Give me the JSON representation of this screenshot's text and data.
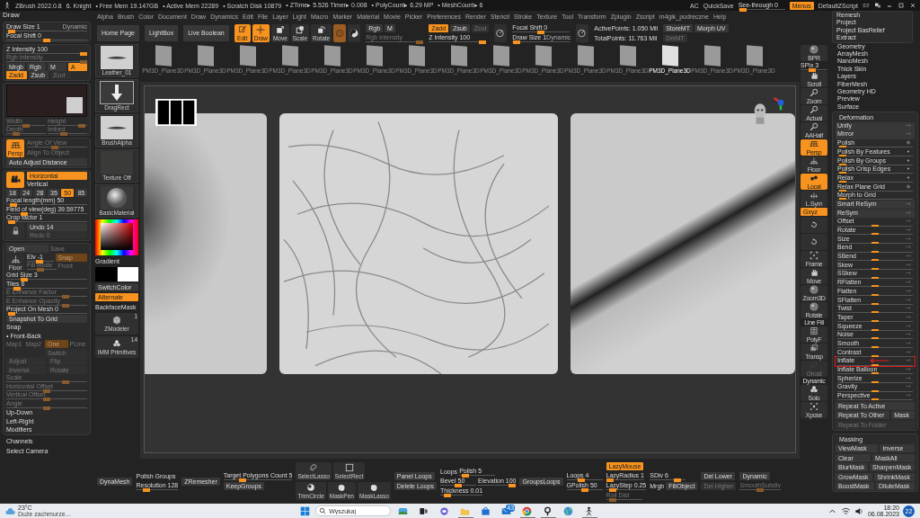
{
  "title_bar": {
    "app": "ZBrush 2022.0.8",
    "document": "6. Knight",
    "stats": [
      "• Free Mem 19.147GB",
      "• Active Mem 22289",
      "• Scratch Disk 10879",
      "• ZTime▸ 5.526 Timer▸ 0.008",
      "• PolyCount▸ 6.29 MP",
      "• MeshCount▸ 6"
    ],
    "right": [
      "AC",
      "QuickSave"
    ],
    "see_through": {
      "kind": "slider",
      "label": "See-through 0",
      "level": 0.02,
      "disabled": false
    },
    "menus_button": {
      "kind": "button",
      "label": "Menus",
      "active": true,
      "disabled": false
    },
    "script": "DefaultZScript"
  },
  "menu_bar": [
    "Alpha",
    "Brush",
    "Color",
    "Document",
    "Draw",
    "Dynamics",
    "Edit",
    "File",
    "Layer",
    "Light",
    "Macro",
    "Marker",
    "Material",
    "Movie",
    "Picker",
    "Preferences",
    "Render",
    "Stencil",
    "Stroke",
    "Texture",
    "Tool",
    "Transform",
    "Zplugin",
    "Zscript",
    "m4gik_podreczne",
    "Help"
  ],
  "left_panel": {
    "title": "Draw",
    "groups": [
      {
        "rows": [
          {
            "cells": [
              {
                "kind": "slider",
                "label": "Draw Size 1",
                "tag": "Dynamic",
                "level": 0.02,
                "disabled": false
              }
            ]
          },
          {
            "cells": [
              {
                "kind": "slider",
                "label": "Focal Shift 0",
                "level": 0.5,
                "disabled": false
              }
            ]
          }
        ]
      },
      {
        "rows": [
          {
            "cells": [
              {
                "kind": "slider",
                "label": "Z Intensity 100",
                "level": 1,
                "disabled": false
              }
            ]
          },
          {
            "cells": [
              {
                "kind": "slider",
                "label": "Rgb Intensity",
                "level": 1,
                "disabled": true
              }
            ]
          },
          {
            "cells": [
              {
                "kind": "button",
                "label": "Mrgb",
                "active": false,
                "disabled": false
              },
              {
                "kind": "button",
                "label": "Rgb",
                "active": false,
                "disabled": false
              },
              {
                "kind": "button",
                "label": "M",
                "active": false,
                "disabled": false
              },
              {
                "kind": "button",
                "label": "A",
                "active": true,
                "disabled": false
              }
            ]
          },
          {
            "cells": [
              {
                "kind": "button",
                "label": "Zadd",
                "active": true,
                "disabled": false
              },
              {
                "kind": "button",
                "label": "Zsub",
                "active": false,
                "disabled": false
              },
              {
                "kind": "button",
                "label": "Zcut",
                "active": false,
                "disabled": true
              },
              {
                "kind": "space"
              }
            ]
          }
        ]
      },
      {
        "rows": [
          {
            "kind": "texture"
          },
          {
            "cells": [
              {
                "kind": "slider",
                "label": "Width",
                "level": 0.5,
                "disabled": true
              },
              {
                "kind": "slider",
                "label": "Height",
                "level": 0.95,
                "disabled": true
              }
            ]
          },
          {
            "cells": [
              {
                "kind": "slider",
                "label": "Depth",
                "level": 0.2,
                "disabled": true
              },
              {
                "kind": "slider",
                "label": "Imbed",
                "level": 0.4,
                "disabled": true
              }
            ]
          }
        ]
      },
      {
        "rows": [
          {
            "kind": "persp",
            "label": "Persp",
            "active": true,
            "rows": [
              {
                "cells": [
                  {
                    "kind": "slider",
                    "label": "Angle Of View",
                    "level": 0.45,
                    "disabled": true
                  }
                ]
              },
              {
                "cells": [
                  {
                    "kind": "text",
                    "label": "Align To Object",
                    "disabled": true
                  }
                ]
              }
            ]
          },
          {
            "cells": [
              {
                "kind": "button",
                "label": "Auto Adjust Distance",
                "active": false,
                "disabled": false
              }
            ]
          }
        ]
      },
      {
        "rows": [
          {
            "kind": "camera",
            "active": true,
            "rows": [
              {
                "cells": [
                  {
                    "kind": "button",
                    "label": "Horizontal",
                    "active": true,
                    "disabled": false
                  }
                ]
              },
              {
                "cells": [
                  {
                    "kind": "text",
                    "label": "Vertical",
                    "disabled": false
                  }
                ]
              }
            ]
          },
          {
            "cells": [
              {
                "kind": "button",
                "label": "18",
                "active": false,
                "disabled": false
              },
              {
                "kind": "button",
                "label": "24",
                "active": false,
                "disabled": false
              },
              {
                "kind": "button",
                "label": "28",
                "active": false,
                "disabled": false
              },
              {
                "kind": "button",
                "label": "35",
                "active": false,
                "disabled": false
              },
              {
                "kind": "button",
                "label": "50",
                "active": true,
                "disabled": false
              },
              {
                "kind": "button",
                "label": "85",
                "active": false,
                "disabled": false
              }
            ]
          },
          {
            "cells": [
              {
                "kind": "slider",
                "label": "Focal length(mm) 50",
                "level": 0.05,
                "disabled": false
              }
            ]
          },
          {
            "cells": [
              {
                "kind": "slider",
                "label": "Field of view(deg) 39.59775",
                "level": 0.2,
                "disabled": false
              }
            ]
          },
          {
            "cells": [
              {
                "kind": "slider",
                "label": "Crop factor 1",
                "level": 0.03,
                "disabled": false
              }
            ]
          },
          {
            "kind": "lock",
            "active": false,
            "rows": [
              {
                "cells": [
                  {
                    "kind": "button",
                    "label": "Undo 14",
                    "active": false,
                    "disabled": false
                  }
                ]
              },
              {
                "cells": [
                  {
                    "kind": "button",
                    "label": "Redo 0",
                    "active": false,
                    "disabled": true
                  }
                ]
              }
            ]
          }
        ]
      },
      {
        "rows": [
          {
            "cells": [
              {
                "kind": "button",
                "label": "Open",
                "active": false,
                "disabled": false
              },
              {
                "kind": "text",
                "label": "Save",
                "disabled": true
              }
            ]
          },
          {
            "kind": "floor",
            "label": "Floor",
            "active": false,
            "rows": [
              {
                "cells": [
                  {
                    "kind": "slider",
                    "label": "Elv -1",
                    "level": 0.45,
                    "disabled": false
                  },
                  {
                    "kind": "button",
                    "label": "Snap",
                    "active": true,
                    "disabled": true
                  }
                ]
              },
              {
                "cells": [
                  {
                    "kind": "slider",
                    "label": "Fill Mode",
                    "level": 0.45,
                    "disabled": true
                  },
                  {
                    "kind": "text",
                    "label": "Front",
                    "disabled": true
                  }
                ]
              }
            ]
          },
          {
            "cells": [
              {
                "kind": "slider",
                "label": "Grid Size 3",
                "level": 0.2,
                "disabled": false
              }
            ]
          },
          {
            "cells": [
              {
                "kind": "slider",
                "label": "Tiles 6",
                "level": 0.1,
                "disabled": false
              }
            ]
          },
          {
            "cells": [
              {
                "kind": "slider",
                "label": "E Enhance Factor",
                "level": 0.75,
                "disabled": true
              }
            ]
          },
          {
            "cells": [
              {
                "kind": "slider",
                "label": "E Enhance Opacity",
                "level": 0.75,
                "disabled": true
              }
            ]
          },
          {
            "cells": [
              {
                "kind": "slider",
                "label": "Project On Mesh 0",
                "level": 0.02,
                "disabled": false
              }
            ]
          },
          {
            "cells": [
              {
                "kind": "button",
                "label": "Snapshot To Grid",
                "active": false,
                "disabled": false
              }
            ]
          },
          {
            "cells": [
              {
                "kind": "text",
                "label": "Snap",
                "disabled": false
              }
            ]
          },
          {
            "cells": [
              {
                "kind": "text",
                "label": "• Front-Back",
                "disabled": false
              }
            ]
          },
          {
            "cells": [
              {
                "kind": "text",
                "label": "Map1",
                "disabled": true
              },
              {
                "kind": "text",
                "label": "Map2",
                "disabled": true
              },
              {
                "kind": "button",
                "label": "One",
                "active": true,
                "disabled": true
              },
              {
                "kind": "text",
                "label": "PLine",
                "disabled": true
              }
            ]
          },
          {
            "cells": [
              {
                "kind": "space"
              },
              {
                "kind": "button",
                "label": "Switch",
                "active": false,
                "disabled": true
              }
            ]
          },
          {
            "cells": [
              {
                "kind": "button",
                "label": "Adjust",
                "active": false,
                "disabled": true
              },
              {
                "kind": "button",
                "label": "Flip",
                "active": false,
                "disabled": true
              }
            ]
          },
          {
            "cells": [
              {
                "kind": "button",
                "label": "Inverse",
                "active": false,
                "disabled": true
              },
              {
                "kind": "button",
                "label": "Rotate",
                "active": false,
                "disabled": true
              }
            ]
          },
          {
            "cells": [
              {
                "kind": "slider",
                "label": "Scale",
                "level": 0.75,
                "disabled": true
              }
            ]
          },
          {
            "cells": [
              {
                "kind": "slider",
                "label": "Horizontal Offset",
                "level": 0.5,
                "disabled": true
              }
            ]
          },
          {
            "cells": [
              {
                "kind": "slider",
                "label": "Vertical Offset",
                "level": 0.5,
                "disabled": true
              }
            ]
          },
          {
            "cells": [
              {
                "kind": "slider",
                "label": "Angle",
                "level": 0.5,
                "disabled": true
              }
            ]
          },
          {
            "cells": [
              {
                "kind": "text",
                "label": "Up-Down",
                "disabled": false
              }
            ]
          },
          {
            "cells": [
              {
                "kind": "text",
                "label": "Left-Right",
                "disabled": false
              }
            ]
          },
          {
            "cells": [
              {
                "kind": "text",
                "label": "Modifiers",
                "disabled": false
              }
            ]
          }
        ]
      }
    ],
    "footer": [
      "Channels",
      "Select Camera"
    ]
  },
  "top_shelf": [
    {
      "rows": [
        {
          "cells": [
            {
              "kind": "button",
              "label": "Home Page",
              "active": false,
              "disabled": false
            }
          ]
        }
      ]
    },
    {
      "rows": [
        {
          "cells": [
            {
              "kind": "button",
              "label": "LightBox",
              "active": false,
              "disabled": false
            }
          ]
        }
      ]
    },
    {
      "rows": [
        {
          "cells": [
            {
              "kind": "button",
              "label": "Live Boolean",
              "active": false,
              "disabled": false
            }
          ]
        }
      ]
    },
    {
      "rows": [
        {
          "cells": [
            {
              "kind": "edit",
              "label": "Edit",
              "active": true,
              "disabled": false
            },
            {
              "kind": "draw",
              "label": "Draw",
              "active": true,
              "disabled": false
            },
            {
              "kind": "move",
              "label": "Move",
              "active": false,
              "disabled": false
            },
            {
              "kind": "scale",
              "label": "Scale",
              "active": false,
              "disabled": false
            },
            {
              "kind": "rotate",
              "label": "Rotate",
              "active": false,
              "disabled": false
            },
            {
              "kind": "material",
              "active": true,
              "disabled": true
            },
            {
              "kind": "swirl",
              "active": false,
              "disabled": false
            }
          ]
        }
      ]
    },
    {
      "rows": [
        {
          "cells": [
            {
              "kind": "button",
              "label": "Rgb",
              "active": false,
              "disabled": false
            },
            {
              "kind": "button",
              "label": "M",
              "active": false,
              "disabled": false
            }
          ]
        },
        {
          "cells": [
            {
              "kind": "slider",
              "label": "Rgb Intensity",
              "level": 1,
              "disabled": true
            }
          ]
        }
      ]
    },
    {
      "rows": [
        {
          "cells": [
            {
              "kind": "button",
              "label": "Zadd",
              "active": true,
              "disabled": false
            },
            {
              "kind": "button",
              "label": "Zsub",
              "active": false,
              "disabled": false
            },
            {
              "kind": "button",
              "label": "Zcut",
              "active": false,
              "disabled": true
            }
          ]
        },
        {
          "cells": [
            {
              "kind": "slider",
              "label": "Z Intensity 100",
              "level": 1,
              "disabled": false
            }
          ]
        }
      ]
    },
    {
      "rows": [
        {
          "cells": [
            {
              "kind": "dial",
              "active": false,
              "disabled": false
            }
          ]
        }
      ]
    },
    {
      "rows": [
        {
          "cells": [
            {
              "kind": "slider",
              "label": "Focal Shift 0",
              "level": 0.5,
              "disabled": false
            }
          ]
        },
        {
          "cells": [
            {
              "kind": "slider",
              "label": "Draw Size 1",
              "tag": "Dynamic",
              "level": 0.02,
              "disabled": false
            }
          ]
        }
      ]
    },
    {
      "rows": [
        {
          "cells": [
            {
              "kind": "dial",
              "active": false,
              "disabled": false
            }
          ]
        }
      ]
    },
    {
      "rows": [
        {
          "cells": [
            {
              "kind": "text",
              "label": "ActivePoints: 1.050 Mil",
              "disabled": false
            }
          ]
        },
        {
          "cells": [
            {
              "kind": "text",
              "label": "TotalPoints: 11.763 Mil",
              "disabled": false
            }
          ]
        }
      ]
    },
    {
      "rows": [
        {
          "cells": [
            {
              "kind": "button",
              "label": "StoreMT",
              "active": false,
              "disabled": false
            },
            {
              "kind": "button",
              "label": "Morph UV",
              "active": false,
              "disabled": false
            }
          ]
        },
        {
          "cells": [
            {
              "kind": "button",
              "label": "DelMT",
              "active": false,
              "disabled": true
            },
            {
              "kind": "space"
            }
          ]
        }
      ]
    }
  ],
  "tool_column": [
    {
      "kind": "stroke_thumb",
      "label": "Leather_01"
    },
    {
      "kind": "arrow_thumb",
      "label": "DragRect"
    },
    {
      "kind": "stroke_thumb",
      "label": "BrushAlpha"
    },
    {
      "kind": "blank_thumb",
      "label": "Texture Off"
    },
    {
      "kind": "sphere_thumb",
      "label": "BasicMaterial"
    },
    {
      "kind": "picker"
    },
    {
      "kind": "text",
      "label": "Gradient",
      "disabled": false
    },
    {
      "kind": "swatches"
    },
    {
      "kind": "button",
      "label": "SwitchColor",
      "active": false,
      "disabled": false
    },
    {
      "kind": "button",
      "label": "Alternate",
      "active": true,
      "disabled": false
    },
    {
      "kind": "text",
      "label": "BackfaceMask",
      "disabled": false
    },
    {
      "kind": "cube",
      "label": "ZModeler",
      "count": "1",
      "active": false,
      "disabled": false
    },
    {
      "kind": "solo",
      "label": "IMM Primitives",
      "count": "14",
      "active": false,
      "disabled": false
    }
  ],
  "subtool_strip": [
    {
      "label": "PM3D_Plane3D",
      "selected": false
    },
    {
      "label": "PM3D_Plane3D",
      "selected": false
    },
    {
      "label": "PM3D_Plane3D",
      "selected": false
    },
    {
      "label": "PM3D_Plane3D",
      "selected": false
    },
    {
      "label": "PM3D_Plane3D",
      "selected": false
    },
    {
      "label": "PM3D_Plane3D",
      "selected": false
    },
    {
      "label": "PM3D_Plane3D",
      "selected": false
    },
    {
      "label": "PM3D_Plane3D",
      "selected": false
    },
    {
      "label": "PM3D_Plane3D",
      "selected": false
    },
    {
      "label": "PM3D_Plane3D",
      "selected": false
    },
    {
      "label": "PM3D_Plane3D",
      "selected": false
    },
    {
      "label": "PM3D_Plane3D",
      "selected": false
    },
    {
      "label": "PM3D_Plane3D",
      "selected": true
    },
    {
      "label": "PM3D_Plane3D",
      "selected": false
    },
    {
      "label": "PM3D_Plane3D",
      "selected": false
    }
  ],
  "bottom_shelf": [
    {
      "rows": [
        {
          "cells": [
            {
              "kind": "button",
              "label": "DynaMesh",
              "active": false,
              "disabled": false
            }
          ]
        }
      ]
    },
    {
      "rows": [
        {
          "cells": [
            {
              "kind": "text",
              "label": "Polish",
              "disabled": false
            },
            {
              "kind": "text",
              "label": "Groups",
              "disabled": false
            }
          ]
        },
        {
          "cells": [
            {
              "kind": "slider",
              "label": "Resolution 128",
              "level": 0.2,
              "disabled": false
            }
          ]
        }
      ]
    },
    {
      "rows": [
        {
          "cells": [
            {
              "kind": "button",
              "label": "ZRemesher",
              "active": false,
              "disabled": false
            }
          ]
        }
      ]
    },
    {
      "rows": [
        {
          "cells": [
            {
              "kind": "slider",
              "label": "Target Polygons Count 5",
              "level": 0.25,
              "disabled": false
            }
          ]
        },
        {
          "cells": [
            {
              "kind": "button",
              "label": "KeepGroups",
              "active": false,
              "disabled": false
            }
          ]
        }
      ]
    },
    {
      "rows": [
        {
          "cells": [
            {
              "kind": "lasso",
              "label": "SelectLasso",
              "active": false,
              "disabled": false
            },
            {
              "kind": "square",
              "label": "SelectRect",
              "active": false,
              "disabled": false
            }
          ]
        },
        {
          "cells": [
            {
              "kind": "ball",
              "label": "TrimCircle",
              "active": false,
              "disabled": false
            },
            {
              "kind": "blob",
              "label": "MaskPen",
              "active": false,
              "disabled": false
            },
            {
              "kind": "blob",
              "label": "MaskLasso",
              "active": false,
              "disabled": false
            }
          ]
        }
      ]
    },
    {
      "rows": [
        {
          "cells": [
            {
              "kind": "button",
              "label": "Panel Loops",
              "active": false,
              "disabled": false
            }
          ]
        },
        {
          "cells": [
            {
              "kind": "button",
              "label": "Delete Loops",
              "active": false,
              "disabled": false
            }
          ]
        }
      ]
    },
    {
      "rows": [
        {
          "cells": [
            {
              "kind": "text",
              "label": "Loops",
              "disabled": false
            },
            {
              "kind": "slider",
              "label": "Polish 5",
              "level": 0.1,
              "disabled": false
            }
          ]
        },
        {
          "cells": [
            {
              "kind": "slider",
              "label": "Bevel 50",
              "level": 0.5,
              "disabled": false
            },
            {
              "kind": "slider",
              "label": "Elevation 100",
              "level": 1,
              "disabled": false
            }
          ]
        },
        {
          "cells": [
            {
              "kind": "slider",
              "label": "Thickness 0.01",
              "level": 0.1,
              "disabled": false
            }
          ]
        }
      ]
    },
    {
      "rows": [
        {
          "cells": [
            {
              "kind": "button",
              "label": "GroupsLoops",
              "active": false,
              "disabled": false
            }
          ]
        }
      ]
    },
    {
      "rows": [
        {
          "cells": [
            {
              "kind": "slider",
              "label": "Loops 4",
              "level": 0.4,
              "disabled": false
            }
          ]
        },
        {
          "cells": [
            {
              "kind": "slider",
              "label": "GPolish 50",
              "level": 0.5,
              "disabled": false
            }
          ]
        }
      ]
    },
    {
      "rows": [
        {
          "cells": [
            {
              "kind": "button",
              "label": "LazyMouse",
              "active": true,
              "disabled": false
            }
          ]
        },
        {
          "cells": [
            {
              "kind": "slider",
              "label": "LazyRadius 1",
              "level": 0.02,
              "disabled": false
            }
          ]
        },
        {
          "cells": [
            {
              "kind": "slider",
              "label": "LazyStep 0.25",
              "level": 0.1,
              "disabled": false
            }
          ]
        },
        {
          "cells": [
            {
              "kind": "slider",
              "label": "Roll Dist",
              "level": 0.1,
              "disabled": true
            }
          ]
        }
      ]
    },
    {
      "rows": [
        {
          "cells": [
            {
              "kind": "slider",
              "label": "SDiv 6",
              "level": 0.85,
              "disabled": false
            }
          ]
        },
        {
          "cells": [
            {
              "kind": "text",
              "label": "Mrgb",
              "disabled": false
            },
            {
              "kind": "button",
              "label": "FillObject",
              "active": false,
              "disabled": false
            }
          ]
        }
      ]
    },
    {
      "rows": [
        {
          "cells": [
            {
              "kind": "button",
              "label": "Del Lower",
              "active": false,
              "disabled": false
            }
          ]
        },
        {
          "cells": [
            {
              "kind": "button",
              "label": "Del Higher",
              "active": false,
              "disabled": true
            }
          ]
        }
      ]
    },
    {
      "rows": [
        {
          "cells": [
            {
              "kind": "button",
              "label": "Dynamic",
              "active": false,
              "disabled": false
            }
          ]
        },
        {
          "cells": [
            {
              "kind": "slider",
              "label": "SmoothSubdiv",
              "level": 0.5,
              "disabled": true
            }
          ]
        }
      ]
    }
  ],
  "view_shelf": [
    {
      "kind": "sphere",
      "label": "BPR",
      "active": false,
      "disabled": false
    },
    {
      "kind": "slider",
      "label": "SPix 3",
      "level": 0.4,
      "disabled": false
    },
    {
      "kind": "hand",
      "label": "Scroll",
      "active": false,
      "disabled": false
    },
    {
      "kind": "zoom",
      "label": "Zoom",
      "active": false,
      "disabled": false
    },
    {
      "kind": "zoom",
      "label": "Actual",
      "active": false,
      "disabled": false
    },
    {
      "kind": "zoom",
      "label": "AAHalf",
      "active": false,
      "disabled": false
    },
    {
      "kind": "persp",
      "label": "Persp",
      "active": true,
      "disabled": false
    },
    {
      "kind": "floor",
      "label": "Floor",
      "active": false,
      "disabled": false
    },
    {
      "kind": "local",
      "label": "Local",
      "active": true,
      "disabled": false
    },
    {
      "kind": "lsym",
      "label": "L.Sym",
      "active": false,
      "disabled": false
    },
    {
      "kind": "button",
      "label": "Gxyz",
      "active": true,
      "disabled": false
    },
    {
      "kind": "rot",
      "active": false,
      "disabled": false
    },
    {
      "kind": "rot",
      "active": false,
      "disabled": false
    },
    {
      "kind": "frame",
      "label": "Frame",
      "active": false,
      "disabled": false
    },
    {
      "kind": "hand",
      "label": "Move",
      "active": false,
      "disabled": false
    },
    {
      "kind": "sphere",
      "label": "Zoom3D",
      "active": false,
      "disabled": false
    },
    {
      "kind": "sphere",
      "label": "Rotate",
      "active": false,
      "disabled": false
    },
    {
      "kind": "text",
      "label": "Line Fill",
      "disabled": false
    },
    {
      "kind": "grid",
      "label": "PolyF",
      "active": false,
      "disabled": false
    },
    {
      "kind": "layers",
      "label": "Transp",
      "active": false,
      "disabled": false
    },
    {
      "kind": "ghost",
      "label": "Ghost",
      "active": false,
      "disabled": true
    },
    {
      "kind": "text",
      "label": "Dynamic",
      "disabled": false
    },
    {
      "kind": "solo",
      "label": "Solo",
      "active": false,
      "disabled": false
    },
    {
      "kind": "xpose",
      "label": "Xpose",
      "active": false,
      "disabled": false
    }
  ],
  "right_panel": {
    "dropdown": [
      "Remesh",
      "Project",
      "Project BasRelief",
      "Extract"
    ],
    "subpalettes": [
      "Geometry",
      "ArrayMesh",
      "NanoMesh",
      "Thick Skin",
      "Layers",
      "FiberMesh",
      "Geometry HD",
      "Preview",
      "Surface"
    ],
    "deformation": {
      "title": "Deformation",
      "items": [
        {
          "kind": "button_xyz",
          "label": "Unify",
          "highlighted": false
        },
        {
          "kind": "button_xyz",
          "label": "Mirror",
          "highlighted": false
        },
        {
          "kind": "slider_circle",
          "label": "Polish",
          "level": 0.02,
          "highlighted": false
        },
        {
          "kind": "slider_dot",
          "label": "Polish By Features",
          "level": 0.02,
          "highlighted": false
        },
        {
          "kind": "slider_dot",
          "label": "Polish By Groups",
          "level": 0.02,
          "highlighted": false
        },
        {
          "kind": "slider_dot",
          "label": "Polish Crisp Edges",
          "level": 0.02,
          "highlighted": false
        },
        {
          "kind": "slider_dot",
          "label": "Relax",
          "level": 0.02,
          "highlighted": false
        },
        {
          "kind": "slider_circle",
          "label": "Relax Plane Grid",
          "level": 0.02,
          "highlighted": false
        },
        {
          "kind": "slider",
          "label": "Morph to Grid",
          "level": 0.02,
          "highlighted": false
        },
        {
          "kind": "button_xyz",
          "label": "Smart ReSym",
          "highlighted": false
        },
        {
          "kind": "button_xyz",
          "label": "ReSym",
          "highlighted": false
        },
        {
          "kind": "slider_xyz",
          "label": "Offset",
          "level": 0.5,
          "highlighted": false
        },
        {
          "kind": "slider_xyz",
          "label": "Rotate",
          "level": 0.5,
          "highlighted": false
        },
        {
          "kind": "slider_xyz",
          "label": "Size",
          "level": 0.5,
          "highlighted": false
        },
        {
          "kind": "slider_xyz",
          "label": "Bend",
          "level": 0.5,
          "highlighted": false
        },
        {
          "kind": "slider_xyz",
          "label": "SBend",
          "level": 0.5,
          "highlighted": false
        },
        {
          "kind": "slider_xyz",
          "label": "Skew",
          "level": 0.5,
          "highlighted": false
        },
        {
          "kind": "slider_xyz",
          "label": "SSkew",
          "level": 0.5,
          "highlighted": false
        },
        {
          "kind": "slider_xyz",
          "label": "RFlatten",
          "level": 0.5,
          "highlighted": false
        },
        {
          "kind": "slider_xyz",
          "label": "Flatten",
          "level": 0.5,
          "highlighted": false
        },
        {
          "kind": "slider_xyz",
          "label": "SFlatten",
          "level": 0.5,
          "highlighted": false
        },
        {
          "kind": "slider_xyz",
          "label": "Twist",
          "level": 0.5,
          "highlighted": false
        },
        {
          "kind": "slider_xyz",
          "label": "Taper",
          "level": 0.5,
          "highlighted": false
        },
        {
          "kind": "slider_xyz",
          "label": "Squeeze",
          "level": 0.5,
          "highlighted": false
        },
        {
          "kind": "slider_xyz",
          "label": "Noise",
          "level": 0.5,
          "highlighted": false
        },
        {
          "kind": "slider_xyz",
          "label": "Smooth",
          "level": 0.5,
          "highlighted": false
        },
        {
          "kind": "slider_xyz",
          "label": "Contrast",
          "level": 0.5,
          "highlighted": false
        },
        {
          "kind": "slider_xyz",
          "label": "Inflate",
          "level": 0.5,
          "highlighted": true
        },
        {
          "kind": "slider_xyz",
          "label": "Inflate Balloon",
          "level": 0.5,
          "highlighted": false
        },
        {
          "kind": "slider_xyz",
          "label": "Spherize",
          "level": 0.5,
          "highlighted": false
        },
        {
          "kind": "slider_xyz",
          "label": "Gravity",
          "level": 0.5,
          "highlighted": false
        },
        {
          "kind": "slider_xyz",
          "label": "Perspective",
          "level": 0.5,
          "highlighted": false
        }
      ],
      "repeat": [
        [
          {
            "label": "Repeat To Active",
            "disabled": false
          }
        ],
        [
          {
            "label": "Repeat To Other",
            "disabled": false
          },
          {
            "label": "Mask",
            "disabled": false
          }
        ],
        [
          {
            "label": "Repeat To Folder",
            "disabled": true
          }
        ]
      ]
    },
    "masking": {
      "title": "Masking",
      "rows": [
        [
          "ViewMask",
          "Inverse"
        ],
        [
          "Clear",
          "MaskAll"
        ],
        [
          "BlurMask",
          "SharpenMask"
        ],
        [
          "GrowMask",
          "ShrinkMask"
        ],
        [
          "BoostMask",
          "DiluteMask"
        ]
      ]
    }
  },
  "taskbar": {
    "weather": {
      "temperature": "23°C",
      "text": "Duże zachmurze..."
    },
    "search": {
      "placeholder": "Wyszukaj"
    },
    "apps": [
      {
        "kind": "widgets",
        "running": false
      },
      {
        "kind": "taskview",
        "running": false
      },
      {
        "kind": "chat",
        "running": false
      },
      {
        "kind": "folder",
        "running": true
      },
      {
        "kind": "store",
        "running": false
      },
      {
        "kind": "mail",
        "badge": "43",
        "running": false
      },
      {
        "kind": "chrome",
        "running": true
      },
      {
        "kind": "ring",
        "running": true
      },
      {
        "kind": "globe",
        "running": false
      },
      {
        "kind": "figure",
        "running": true
      }
    ],
    "tray": {
      "time": "18:20",
      "date": "06.08.2023",
      "badge": "22"
    }
  }
}
